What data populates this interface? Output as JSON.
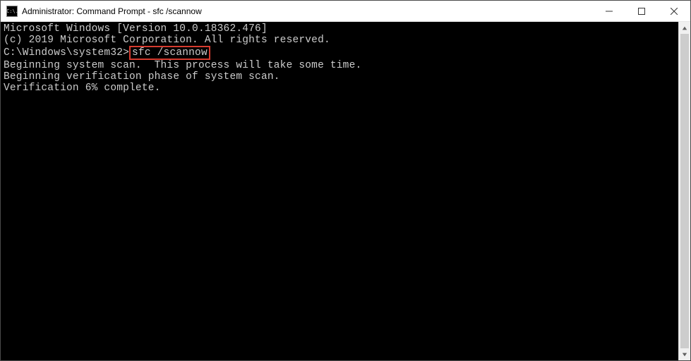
{
  "window": {
    "icon_text": "C:\\.",
    "title": "Administrator: Command Prompt - sfc  /scannow"
  },
  "terminal": {
    "line1": "Microsoft Windows [Version 10.0.18362.476]",
    "line2": "(c) 2019 Microsoft Corporation. All rights reserved.",
    "blank1": "",
    "prompt": "C:\\Windows\\system32>",
    "command": "sfc /scannow",
    "blank2": "",
    "line3": "Beginning system scan.  This process will take some time.",
    "blank3": "",
    "line4": "Beginning verification phase of system scan.",
    "line5": "Verification 6% complete."
  }
}
